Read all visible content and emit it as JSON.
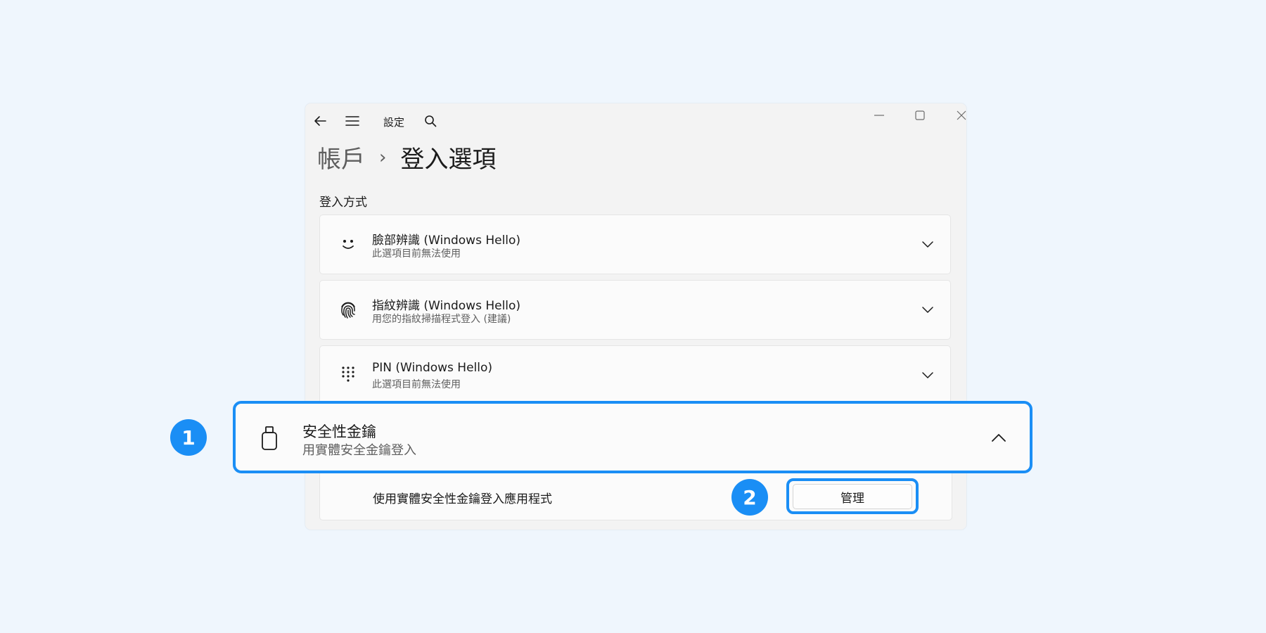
{
  "titlebar": {
    "app_title": "設定",
    "icons": {
      "back": "back-arrow-icon",
      "menu": "hamburger-menu-icon",
      "search": "search-icon",
      "minimize": "minimize-icon",
      "maximize": "maximize-icon",
      "close": "close-icon"
    }
  },
  "breadcrumb": {
    "parent": "帳戶",
    "separator": "›",
    "current": "登入選項"
  },
  "section": {
    "title": "登入方式"
  },
  "sign_in_options": [
    {
      "title": "臉部辨識 (Windows Hello)",
      "subtitle": "此選項目前無法使用",
      "icon": "smiley-face-icon",
      "state": "collapsed"
    },
    {
      "title": "指紋辨識 (Windows Hello)",
      "subtitle": "用您的指紋掃描程式登入 (建議)",
      "icon": "fingerprint-icon",
      "state": "collapsed"
    },
    {
      "title": "PIN (Windows Hello)",
      "subtitle": "此選項目前無法使用",
      "icon": "pin-keypad-icon",
      "state": "collapsed"
    },
    {
      "title": "安全性金鑰",
      "subtitle": "用實體安全金鑰登入",
      "icon": "usb-security-key-icon",
      "state": "expanded"
    }
  ],
  "security_key_panel": {
    "description": "使用實體安全性金鑰登入應用程式",
    "manage_label": "管理"
  },
  "callouts": {
    "step1": "1",
    "step2": "2"
  },
  "colors": {
    "accent": "#1a8ef5",
    "background": "#eff6fd",
    "window": "#f3f3f3",
    "card": "#fbfbfb"
  }
}
